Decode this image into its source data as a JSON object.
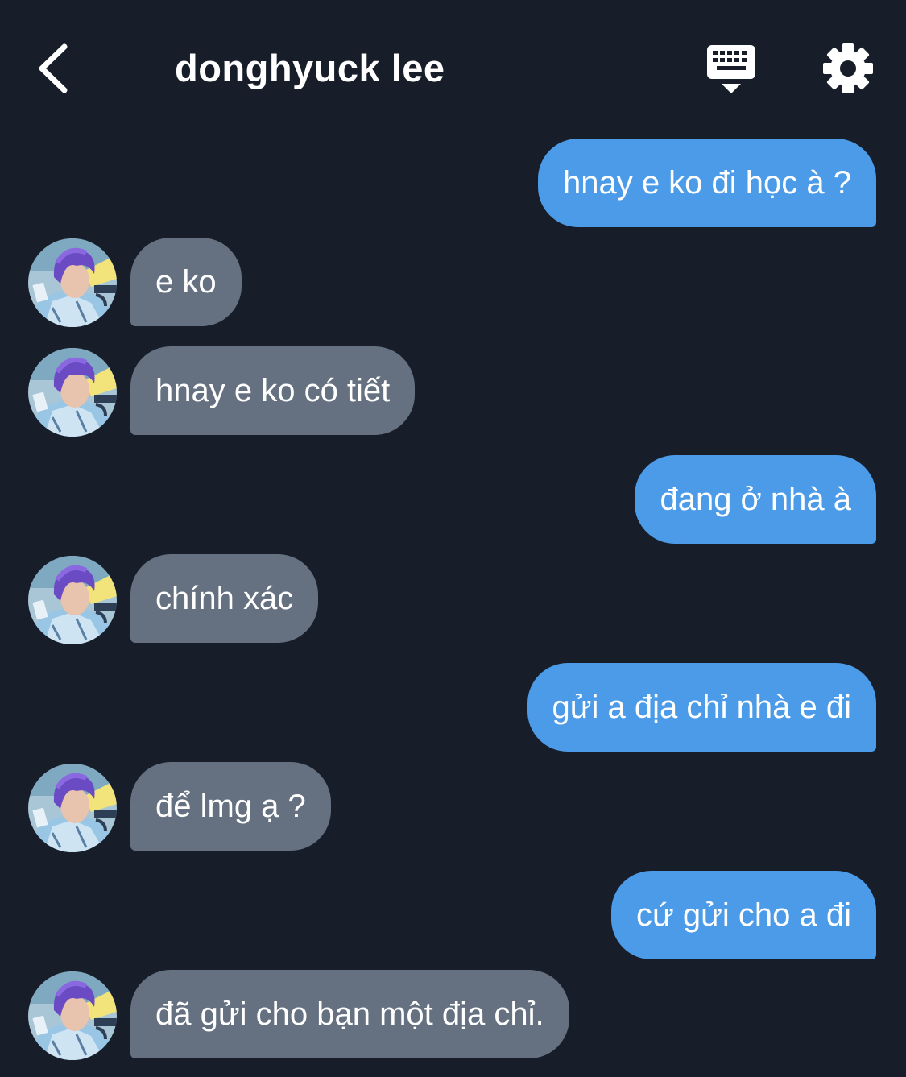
{
  "header": {
    "title": "donghyuck lee",
    "back_icon": "chevron-left-icon",
    "keyboard_icon": "keyboard-icon",
    "settings_icon": "gear-icon"
  },
  "colors": {
    "background": "#171e29",
    "sent_bubble": "#4b9be8",
    "received_bubble": "#657180",
    "text": "#ffffff"
  },
  "messages": [
    {
      "side": "sent",
      "text": "hnay e ko đi học à ?"
    },
    {
      "side": "received",
      "text": "e ko"
    },
    {
      "side": "received",
      "text": "hnay e ko có tiết"
    },
    {
      "side": "sent",
      "text": "đang ở nhà à"
    },
    {
      "side": "received",
      "text": "chính xác"
    },
    {
      "side": "sent",
      "text": "gửi a địa chỉ nhà e đi"
    },
    {
      "side": "received",
      "text": "để lmg ạ ?"
    },
    {
      "side": "sent",
      "text": "cứ gửi cho a đi"
    },
    {
      "side": "received",
      "text": "đã gửi cho bạn một địa chỉ."
    }
  ]
}
